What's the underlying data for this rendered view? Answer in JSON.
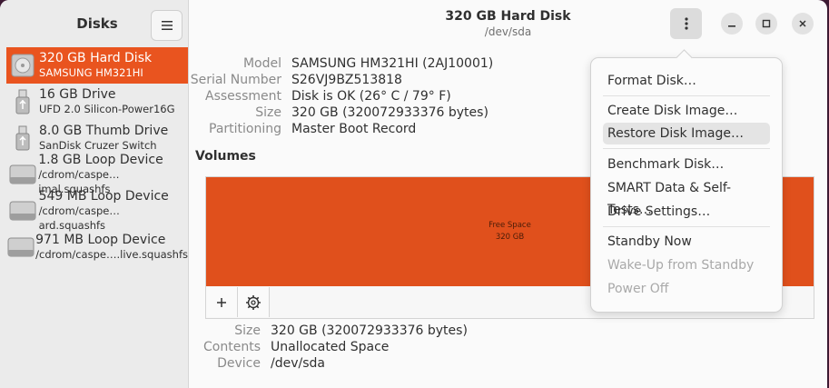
{
  "sidebar": {
    "title": "Disks",
    "devices": [
      {
        "name": "320 GB Hard Disk",
        "sub": "SAMSUNG HM321HI",
        "icon": "hard-disk-icon"
      },
      {
        "name": "16 GB Drive",
        "sub": "UFD 2.0 Silicon-Power16G",
        "icon": "usb-drive-icon"
      },
      {
        "name": "8.0 GB Thumb Drive",
        "sub": "SanDisk Cruzer Switch",
        "icon": "usb-drive-icon"
      },
      {
        "name": "1.8 GB Loop Device",
        "sub": "/cdrom/caspe…imal.squashfs",
        "icon": "loop-device-icon"
      },
      {
        "name": "549 MB Loop Device",
        "sub": "/cdrom/caspe… ard.squashfs",
        "icon": "loop-device-icon"
      },
      {
        "name": "971 MB Loop Device",
        "sub": "/cdrom/caspe….live.squashfs",
        "icon": "loop-device-icon"
      }
    ]
  },
  "header": {
    "title": "320 GB Hard Disk",
    "subtitle": "/dev/sda"
  },
  "disk_info": {
    "model_label": "Model",
    "model": "SAMSUNG HM321HI (2AJ10001)",
    "serial_label": "Serial Number",
    "serial": "S26VJ9BZ513818",
    "assessment_label": "Assessment",
    "assessment": "Disk is OK (26° C / 79° F)",
    "size_label": "Size",
    "size": "320 GB (320072933376 bytes)",
    "partitioning_label": "Partitioning",
    "partitioning": "Master Boot Record"
  },
  "volumes": {
    "title": "Volumes",
    "partition_name": "Free Space",
    "partition_size": "320 GB"
  },
  "partition_info": {
    "size_label": "Size",
    "size": "320 GB (320072933376 bytes)",
    "contents_label": "Contents",
    "contents": "Unallocated Space",
    "device_label": "Device",
    "device": "/dev/sda"
  },
  "menu": {
    "format": "Format Disk…",
    "create_image": "Create Disk Image…",
    "restore_image": "Restore Disk Image…",
    "benchmark": "Benchmark Disk…",
    "smart": "SMART Data & Self-Tests…",
    "settings": "Drive Settings…",
    "standby": "Standby Now",
    "wakeup": "Wake-Up from Standby",
    "poweroff": "Power Off"
  },
  "colors": {
    "accent": "#e9541f",
    "partition": "#e0501c"
  }
}
